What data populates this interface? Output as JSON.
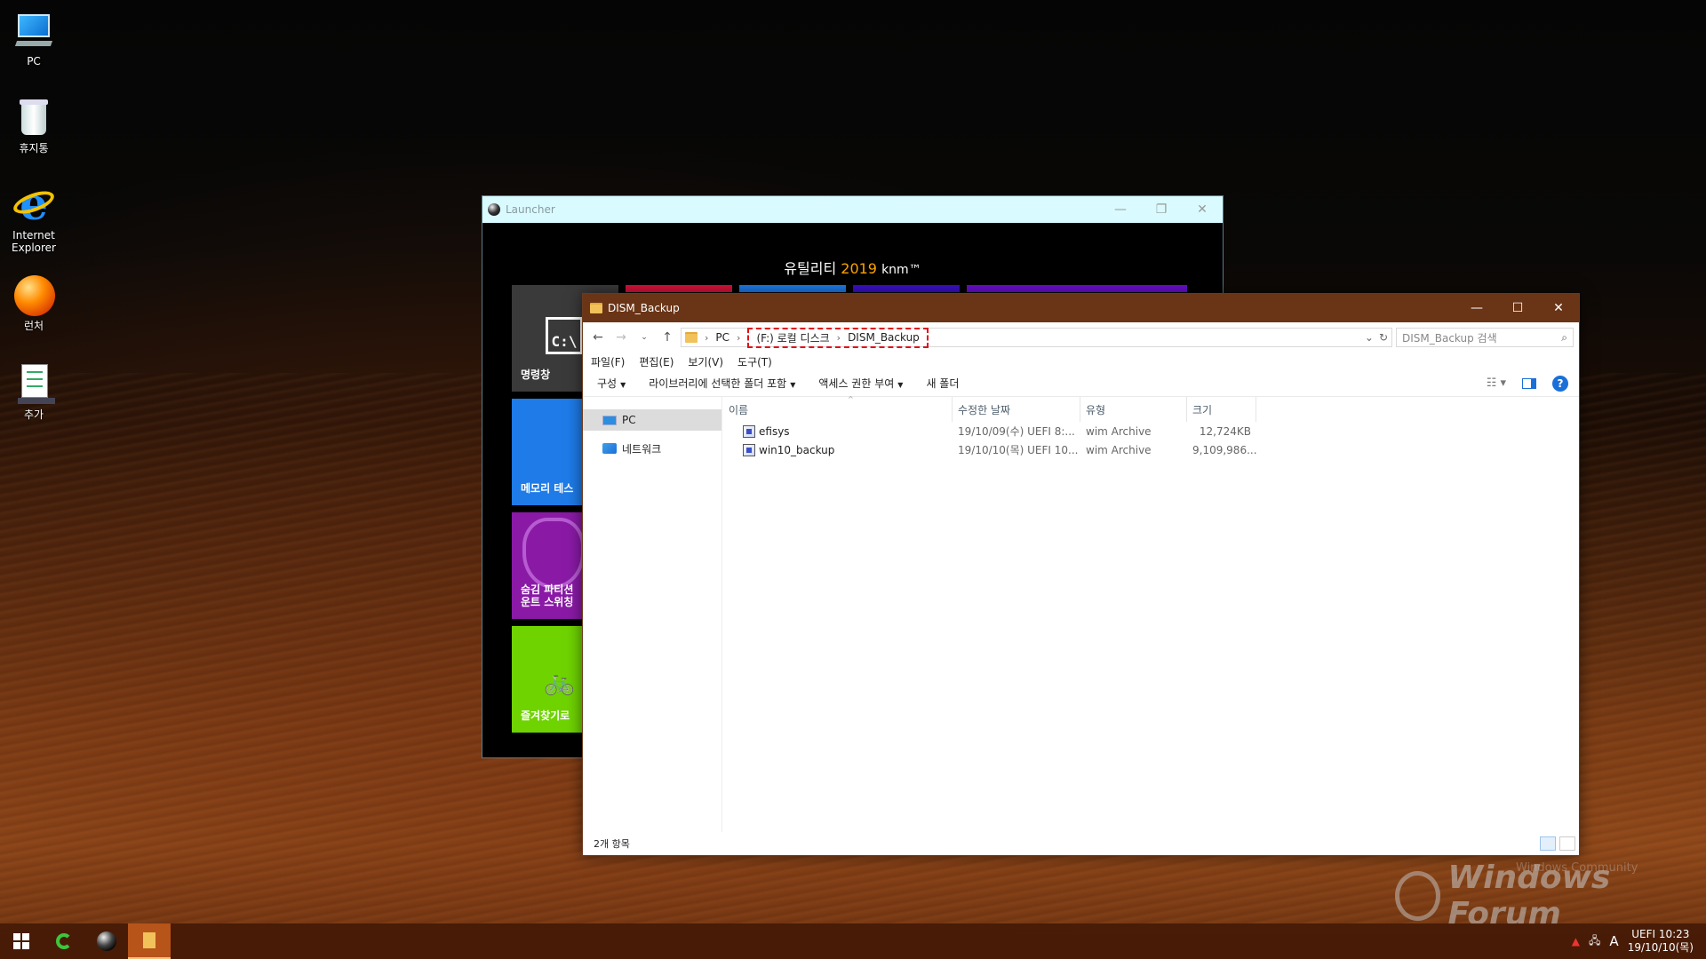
{
  "desktop": {
    "icons": [
      {
        "label": "PC"
      },
      {
        "label": "휴지통"
      },
      {
        "label": "Internet Explorer"
      },
      {
        "label": "런처"
      },
      {
        "label": "추가"
      }
    ]
  },
  "launcher": {
    "title": "Launcher",
    "heading_prefix": "유틸리티",
    "heading_year": "2019",
    "heading_suffix": "knm™",
    "tiles": [
      {
        "label": "명령창",
        "glyph": "C:\\",
        "color": "#3a3a3a"
      },
      {
        "label": "메모리 테스",
        "color": "#1e7be8"
      },
      {
        "label": "숨김 파티션 운트 스위칭",
        "color": "#8a1aa6"
      },
      {
        "label": "즐겨찾기로",
        "color": "#6fd300"
      }
    ],
    "top_strip_colors": [
      "#d8123a",
      "#1e7be8",
      "#3b10c9",
      "#6a0fd0"
    ]
  },
  "explorer": {
    "title": "DISM_Backup",
    "breadcrumb": {
      "root": "PC",
      "drive": "(F:) 로컬 디스크",
      "folder": "DISM_Backup"
    },
    "search_placeholder": "DISM_Backup 검색",
    "menu": [
      "파일(F)",
      "편집(E)",
      "보기(V)",
      "도구(T)"
    ],
    "commands": [
      "구성",
      "라이브러리에 선택한 폴더 포함",
      "액세스 권한 부여",
      "새 폴더"
    ],
    "nav": [
      {
        "label": "PC"
      },
      {
        "label": "네트워크"
      }
    ],
    "columns": [
      "이름",
      "수정한 날짜",
      "유형",
      "크기"
    ],
    "files": [
      {
        "name": "efisys",
        "date": "19/10/09(수) UEFI  8:...",
        "type": "wim Archive",
        "size": "12,724KB"
      },
      {
        "name": "win10_backup",
        "date": "19/10/10(목) UEFI  10...",
        "type": "wim Archive",
        "size": "9,109,986..."
      }
    ],
    "status": "2개 항목"
  },
  "watermark": {
    "text": "Windows Forum",
    "sub": "Windows Community"
  },
  "taskbar": {
    "tray_ime": "A",
    "clock_time": "UEFI  10:23",
    "clock_date": "19/10/10(목)"
  },
  "colors": {
    "explorer_title": "#6a3416",
    "launcher_title": "#d9fbff",
    "highlight": "#e0111a"
  }
}
